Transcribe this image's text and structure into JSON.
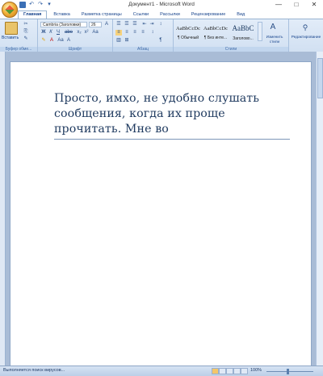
{
  "window": {
    "title": "Документ1 - Microsoft Word",
    "controls": {
      "minimize": "—",
      "maximize": "□",
      "close": "✕"
    }
  },
  "quick_access": {
    "undo": "↶",
    "redo": "↷",
    "more": "▾"
  },
  "tabs": [
    {
      "label": "Главная",
      "active": true
    },
    {
      "label": "Вставка"
    },
    {
      "label": "Разметка страницы"
    },
    {
      "label": "Ссылки"
    },
    {
      "label": "Рассылки"
    },
    {
      "label": "Рецензирование"
    },
    {
      "label": "Вид"
    }
  ],
  "ribbon": {
    "clipboard": {
      "paste_label": "Вставить",
      "group_label": "Буфер обме..."
    },
    "font": {
      "font_name": "Cambria (Заголовки)",
      "font_size": "26",
      "group_label": "Шрифт",
      "bold": "Ж",
      "italic": "К",
      "underline": "Ч",
      "strike": "abe"
    },
    "paragraph": {
      "group_label": "Абзац",
      "pilcrow": "¶"
    },
    "styles": {
      "group_label": "Стили",
      "items": [
        {
          "sample": "AaBbCcDc",
          "name": "¶ Обычный"
        },
        {
          "sample": "AaBbCcDc",
          "name": "¶ Без инте..."
        },
        {
          "sample": "AaBbC",
          "name": "Заголово..."
        }
      ],
      "change_styles": "Изменить стили"
    },
    "editing": {
      "label": "Редактирование"
    }
  },
  "document": {
    "text": "Просто, имхо, не удобно слушать сообщения, когда их проще прочитать. Мне во"
  },
  "status": {
    "text": "Выполняется поиск вирусов...",
    "zoom": "100%"
  },
  "colors": {
    "ribbon_bg": "#dbe7f6",
    "accent": "#15428b"
  }
}
